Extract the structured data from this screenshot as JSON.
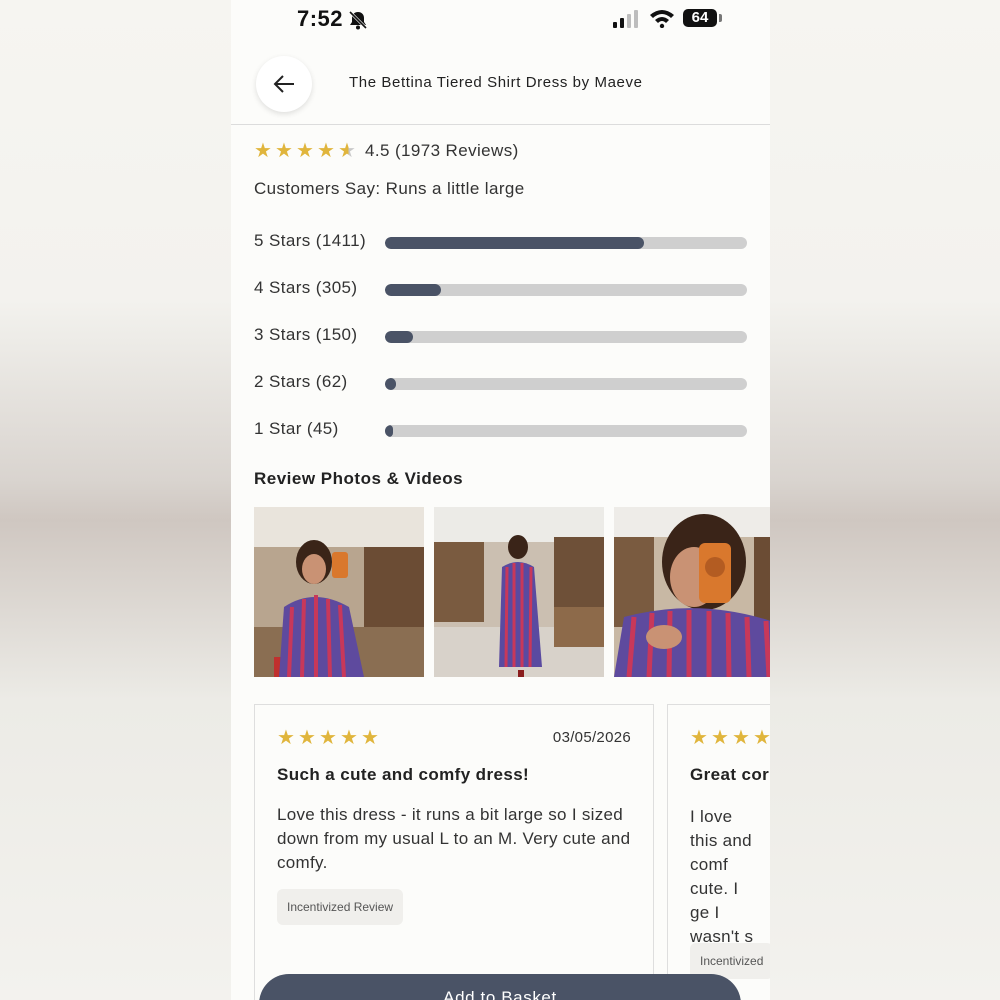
{
  "status_bar": {
    "time": "7:52",
    "battery": "64"
  },
  "header": {
    "title": "The Bettina Tiered Shirt Dress by Maeve",
    "back_icon": "arrow-left-icon"
  },
  "rating": {
    "stars": 4.5,
    "summary_text": "4.5 (1973 Reviews)",
    "customers_say": "Customers Say: Runs a little large"
  },
  "breakdown": [
    {
      "label": "5 Stars (1411)",
      "count": 1411,
      "fraction": 0.715
    },
    {
      "label": "4 Stars (305)",
      "count": 305,
      "fraction": 0.155
    },
    {
      "label": "3 Stars (150)",
      "count": 150,
      "fraction": 0.076
    },
    {
      "label": "2 Stars (62)",
      "count": 62,
      "fraction": 0.031
    },
    {
      "label": "1 Star (45)",
      "count": 45,
      "fraction": 0.023
    }
  ],
  "photos_section": {
    "title": "Review Photos & Videos"
  },
  "reviews": [
    {
      "stars": 5,
      "date": "03/05/2026",
      "title": "Such a cute and comfy dress!",
      "body": "Love this dress - it runs a bit large so I sized down from my usual L to an M. Very cute and comfy.",
      "tag": "Incentivized Review"
    },
    {
      "stars": 5,
      "date": "",
      "title": "Great cor",
      "body": "I love this and comf cute. I ge I wasn't s me since",
      "tag": "Incentivized"
    }
  ],
  "cta": {
    "label": "Add to Basket"
  },
  "colors": {
    "star": "#e0b53c",
    "bar_fill": "#4a5366",
    "bar_track": "#cfcfcf",
    "button": "#4a5366"
  }
}
